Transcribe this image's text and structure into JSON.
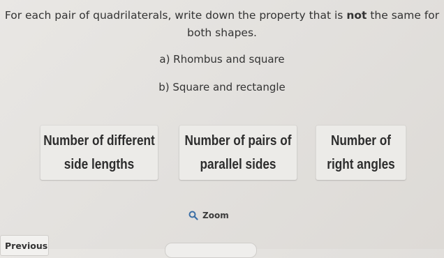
{
  "question": {
    "line1_pre": "For each pair of quadrilaterals, write down the property that is ",
    "line1_bold": "not",
    "line1_post": " the same for",
    "line2": "both shapes."
  },
  "parts": {
    "a": "a) Rhombus and square",
    "b": "b) Square and rectangle"
  },
  "cards": [
    {
      "line1": "Number of different",
      "line2": "side lengths"
    },
    {
      "line1": "Number of pairs of",
      "line2": "parallel sides"
    },
    {
      "line1": "Number of",
      "line2": "right angles"
    }
  ],
  "zoom": {
    "label": "Zoom",
    "icon": "magnifier-icon"
  },
  "nav": {
    "previous_label": "Previous"
  }
}
